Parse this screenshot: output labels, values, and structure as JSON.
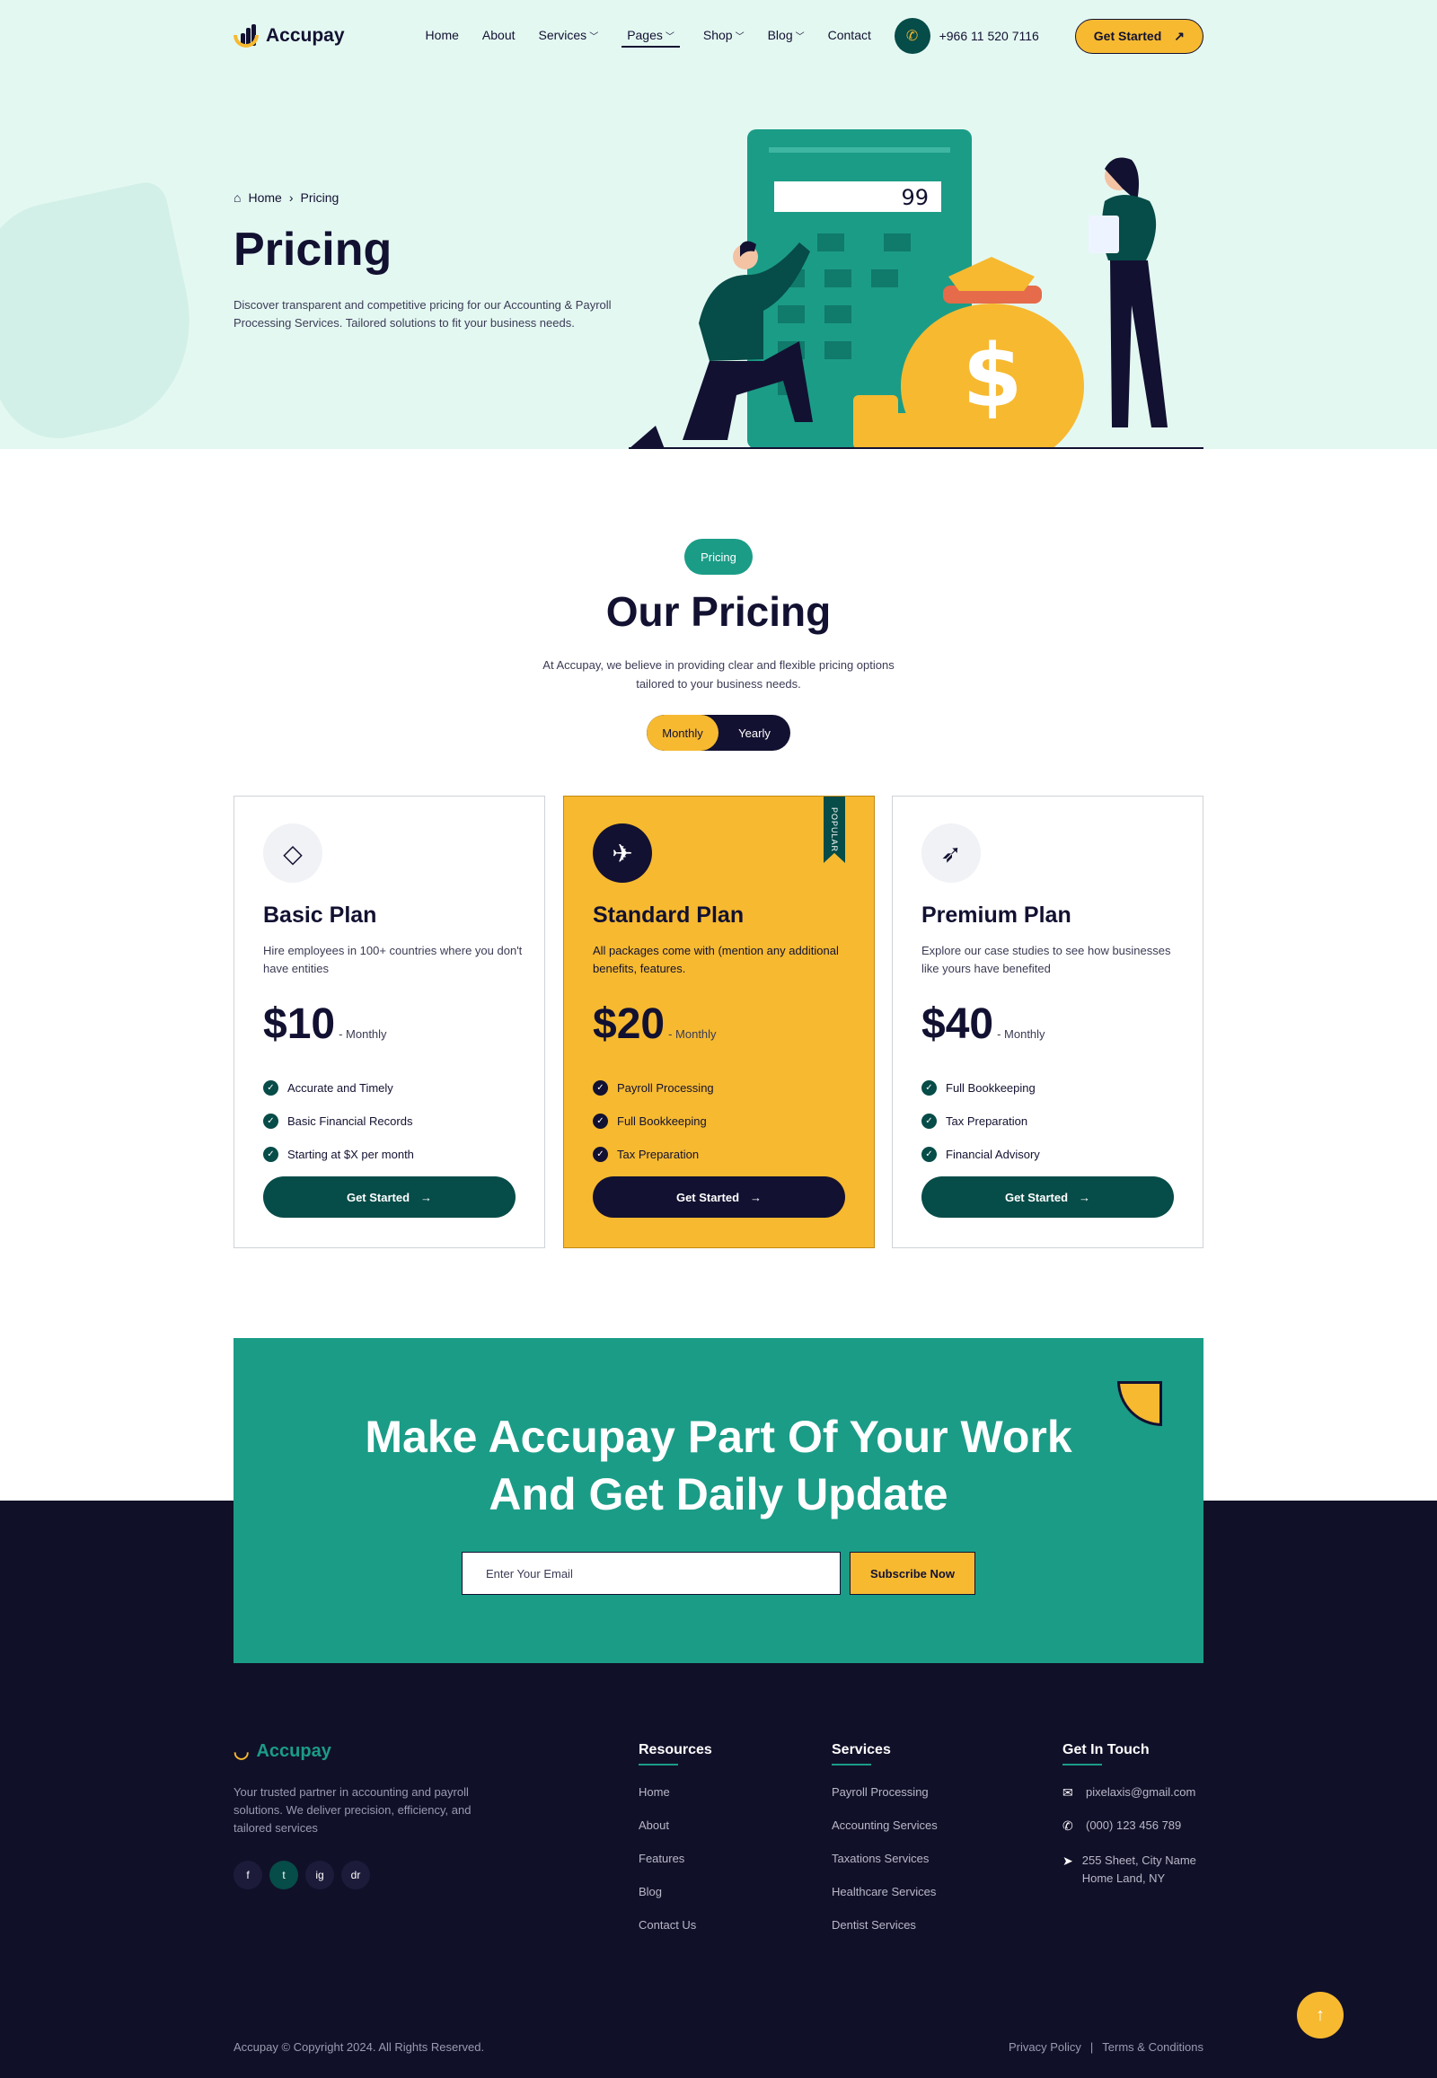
{
  "brand": {
    "name": "Accupay"
  },
  "nav": {
    "items": [
      {
        "label": "Home"
      },
      {
        "label": "About"
      },
      {
        "label": "Services"
      },
      {
        "label": "Pages"
      },
      {
        "label": "Shop"
      },
      {
        "label": "Blog"
      },
      {
        "label": "Contact"
      }
    ],
    "phone": "+966 11 520 7116",
    "cta": "Get Started"
  },
  "hero": {
    "breadcrumb": {
      "home": "Home",
      "current": "Pricing"
    },
    "title": "Pricing",
    "description": "Discover transparent and competitive pricing for our Accounting & Payroll Processing Services. Tailored solutions to fit your business needs.",
    "calculator_display": "99"
  },
  "pricing": {
    "tag": "Pricing",
    "title": "Our Pricing",
    "description": "At Accupay, we believe in providing clear and flexible pricing options tailored to your business needs.",
    "toggle": {
      "monthly": "Monthly",
      "yearly": "Yearly",
      "selected": "Monthly"
    },
    "plans": [
      {
        "name": "Basic Plan",
        "icon": "kite-icon",
        "description": "Hire employees in 100+ countries where you don't have entities",
        "price": "$10",
        "period": "- Monthly",
        "features": [
          "Accurate and Timely",
          "Basic Financial Records",
          "Starting at $X per month"
        ],
        "button": "Get Started"
      },
      {
        "name": "Standard Plan",
        "icon": "airplane-icon",
        "description": "All packages come with (mention any additional benefits, features.",
        "price": "$20",
        "period": "- Monthly",
        "features": [
          "Payroll Processing",
          "Full Bookkeeping",
          "Tax Preparation"
        ],
        "button": "Get Started",
        "badge": "POPULAR"
      },
      {
        "name": "Premium Plan",
        "icon": "rocket-icon",
        "description": "Explore our case studies to see how businesses like yours have benefited",
        "price": "$40",
        "period": "- Monthly",
        "features": [
          "Full Bookkeeping",
          "Tax Preparation",
          "Financial Advisory"
        ],
        "button": "Get Started"
      }
    ]
  },
  "newsletter": {
    "title_line1": "Make Accupay Part Of Your Work",
    "title_line2": "And Get Daily Update",
    "placeholder": "Enter Your Email",
    "button": "Subscribe Now"
  },
  "footer": {
    "about": "Your trusted partner in accounting and payroll solutions. We deliver precision, efficiency, and tailored services",
    "socials": [
      "f",
      "t",
      "ig",
      "dr"
    ],
    "resources": {
      "title": "Resources",
      "links": [
        "Home",
        "About",
        "Features",
        "Blog",
        "Contact Us"
      ]
    },
    "services": {
      "title": "Services",
      "links": [
        "Payroll Processing",
        "Accounting Services",
        "Taxations Services",
        "Healthcare Services",
        "Dentist Services"
      ]
    },
    "contact": {
      "title": "Get In Touch",
      "email": "pixelaxis@gmail.com",
      "phone": "(000) 123 456 789",
      "address": "255 Sheet, City Name Home Land, NY"
    },
    "copyright": "Accupay © Copyright 2024. All Rights Reserved.",
    "privacy": "Privacy Policy",
    "terms": "Terms & Conditions"
  },
  "colors": {
    "accent": "#f6b930",
    "teal": "#1b9c87",
    "dark_green": "#064c48",
    "navy": "#111029",
    "hero_bg": "#e4f8f2"
  }
}
